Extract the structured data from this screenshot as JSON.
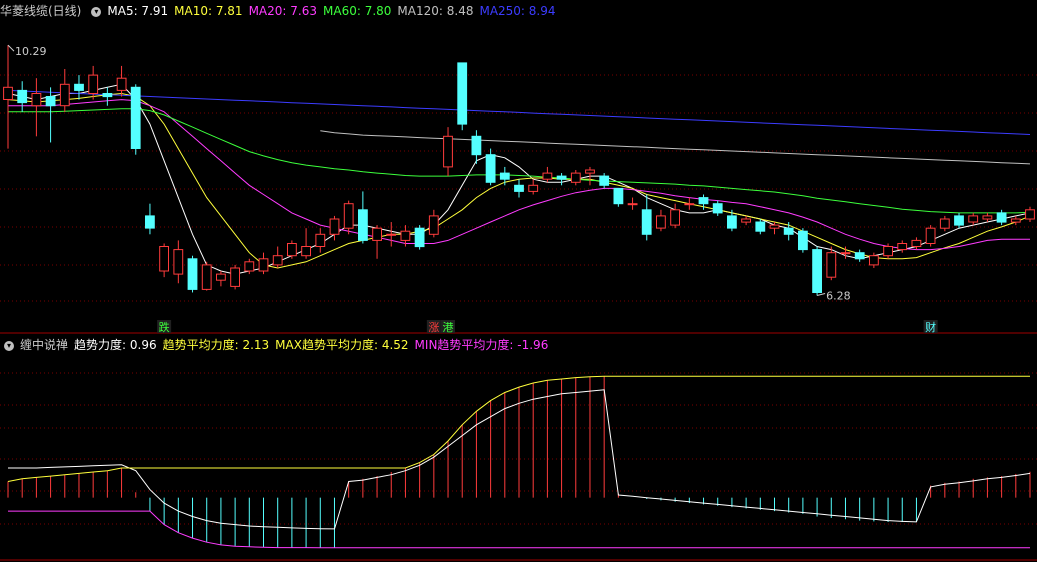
{
  "colors": {
    "bg": "#000000",
    "up": "#ff3c3c",
    "down": "#54ffff",
    "grid": "#7a0000",
    "ma5": "#ffffff",
    "ma10": "#ffff3c",
    "ma20": "#ff3cff",
    "ma60": "#3cff3c",
    "ma120": "#c0c0c0",
    "ma250": "#3c3cff",
    "axis": "#a00000"
  },
  "price_panel": {
    "title": "华菱线缆(日线)",
    "indicators": [
      {
        "label": "MA5: 7.91",
        "color": "#ffffff"
      },
      {
        "label": "MA10: 7.81",
        "color": "#ffff3c"
      },
      {
        "label": "MA20: 7.63",
        "color": "#ff3cff"
      },
      {
        "label": "MA60: 7.80",
        "color": "#3cff3c"
      },
      {
        "label": "MA120: 8.48",
        "color": "#c0c0c0"
      },
      {
        "label": "MA250: 8.94",
        "color": "#3c3cff"
      }
    ],
    "high_label": "10.29",
    "low_label": "6.28",
    "markers": [
      {
        "text": "跌",
        "index": 11,
        "color": "#3cff3c"
      },
      {
        "text": "涨",
        "index": 30,
        "color": "#ff3c3c"
      },
      {
        "text": "港",
        "index": 31,
        "color": "#3cff3c"
      },
      {
        "text": "财",
        "index": 65,
        "color": "#54ffff"
      }
    ]
  },
  "indicator_panel": {
    "title": "缠中说禅",
    "values": [
      {
        "label": "趋势力度: 0.96",
        "color": "#ffffff"
      },
      {
        "label": "趋势平均力度: 2.13",
        "color": "#ffff3c"
      },
      {
        "label": "MAX趋势平均力度: 4.52",
        "color": "#ffff3c"
      },
      {
        "label": "MIN趋势平均力度: -1.96",
        "color": "#ff3cff"
      }
    ]
  },
  "chart_data": [
    {
      "type": "candlestick",
      "title": "华菱线缆(日线)",
      "ylim": [
        5.8,
        10.7
      ],
      "candles": [
        [
          9.4,
          9.6,
          10.29,
          8.6
        ],
        [
          9.55,
          9.35,
          9.7,
          9.2
        ],
        [
          9.3,
          9.5,
          9.75,
          8.8
        ],
        [
          9.45,
          9.3,
          9.6,
          8.7
        ],
        [
          9.3,
          9.65,
          9.9,
          9.2
        ],
        [
          9.65,
          9.55,
          9.8,
          9.4
        ],
        [
          9.5,
          9.8,
          9.95,
          9.4
        ],
        [
          9.5,
          9.45,
          9.6,
          9.3
        ],
        [
          9.55,
          9.75,
          9.95,
          9.45
        ],
        [
          9.6,
          8.6,
          9.65,
          8.5
        ],
        [
          7.5,
          7.3,
          7.7,
          7.2
        ],
        [
          6.6,
          7.0,
          7.05,
          6.5
        ],
        [
          6.55,
          6.95,
          7.1,
          6.4
        ],
        [
          6.8,
          6.3,
          6.85,
          6.25
        ],
        [
          6.3,
          6.7,
          6.75,
          6.28
        ],
        [
          6.45,
          6.55,
          6.6,
          6.35
        ],
        [
          6.35,
          6.65,
          6.7,
          6.3
        ],
        [
          6.6,
          6.75,
          6.8,
          6.55
        ],
        [
          6.6,
          6.8,
          6.9,
          6.55
        ],
        [
          6.7,
          6.85,
          7.0,
          6.65
        ],
        [
          6.85,
          7.05,
          7.1,
          6.8
        ],
        [
          6.85,
          7.0,
          7.3,
          6.8
        ],
        [
          7.0,
          7.2,
          7.3,
          6.9
        ],
        [
          7.2,
          7.45,
          7.5,
          7.1
        ],
        [
          7.3,
          7.7,
          7.75,
          7.2
        ],
        [
          7.6,
          7.1,
          7.9,
          7.05
        ],
        [
          7.1,
          7.3,
          7.35,
          6.8
        ],
        [
          7.2,
          7.2,
          7.4,
          7.0
        ],
        [
          7.1,
          7.25,
          7.35,
          7.0
        ],
        [
          7.3,
          7.0,
          7.35,
          6.95
        ],
        [
          7.2,
          7.5,
          7.6,
          7.15
        ],
        [
          8.3,
          8.8,
          8.95,
          8.15
        ],
        [
          10.0,
          9.0,
          10.0,
          8.9
        ],
        [
          8.8,
          8.5,
          8.9,
          8.35
        ],
        [
          8.5,
          8.05,
          8.6,
          8.0
        ],
        [
          8.2,
          8.1,
          8.3,
          8.0
        ],
        [
          8.0,
          7.9,
          8.1,
          7.8
        ],
        [
          7.9,
          8.0,
          8.1,
          7.85
        ],
        [
          8.1,
          8.2,
          8.3,
          8.05
        ],
        [
          8.15,
          8.1,
          8.2,
          8.0
        ],
        [
          8.05,
          8.2,
          8.25,
          8.0
        ],
        [
          8.2,
          8.25,
          8.3,
          8.0
        ],
        [
          8.15,
          8.0,
          8.2,
          7.95
        ],
        [
          7.95,
          7.7,
          7.95,
          7.65
        ],
        [
          7.7,
          7.7,
          7.8,
          7.6
        ],
        [
          7.6,
          7.2,
          7.85,
          7.1
        ],
        [
          7.3,
          7.5,
          7.6,
          7.25
        ],
        [
          7.35,
          7.6,
          7.7,
          7.3
        ],
        [
          7.7,
          7.7,
          7.8,
          7.6
        ],
        [
          7.8,
          7.7,
          7.85,
          7.6
        ],
        [
          7.7,
          7.55,
          7.75,
          7.5
        ],
        [
          7.5,
          7.3,
          7.6,
          7.25
        ],
        [
          7.4,
          7.45,
          7.5,
          7.35
        ],
        [
          7.4,
          7.25,
          7.45,
          7.2
        ],
        [
          7.3,
          7.35,
          7.4,
          7.2
        ],
        [
          7.3,
          7.2,
          7.4,
          7.1
        ],
        [
          7.25,
          6.95,
          7.3,
          6.9
        ],
        [
          6.95,
          6.25,
          7.0,
          6.2
        ],
        [
          6.5,
          6.9,
          7.0,
          6.45
        ],
        [
          6.9,
          6.9,
          7.0,
          6.8
        ],
        [
          6.9,
          6.8,
          6.95,
          6.75
        ],
        [
          6.7,
          6.85,
          6.9,
          6.65
        ],
        [
          6.85,
          7.0,
          7.05,
          6.8
        ],
        [
          6.95,
          7.05,
          7.1,
          6.9
        ],
        [
          7.0,
          7.1,
          7.15,
          6.95
        ],
        [
          7.05,
          7.3,
          7.35,
          7.0
        ],
        [
          7.3,
          7.45,
          7.5,
          7.25
        ],
        [
          7.5,
          7.35,
          7.55,
          7.3
        ],
        [
          7.4,
          7.5,
          7.55,
          7.35
        ],
        [
          7.45,
          7.5,
          7.55,
          7.4
        ],
        [
          7.55,
          7.4,
          7.6,
          7.35
        ],
        [
          7.4,
          7.45,
          7.5,
          7.35
        ],
        [
          7.45,
          7.6,
          7.65,
          7.4
        ]
      ],
      "ma": {
        "MA5": [
          9.5,
          9.45,
          9.4,
          9.45,
          9.5,
          9.5,
          9.55,
          9.6,
          9.65,
          9.4,
          9.0,
          8.4,
          7.8,
          7.2,
          6.7,
          6.6,
          6.55,
          6.6,
          6.65,
          6.75,
          6.85,
          6.95,
          7.05,
          7.2,
          7.35,
          7.35,
          7.3,
          7.25,
          7.2,
          7.2,
          7.35,
          7.6,
          8.0,
          8.4,
          8.5,
          8.45,
          8.3,
          8.1,
          8.05,
          8.05,
          8.1,
          8.15,
          8.15,
          8.05,
          7.95,
          7.8,
          7.7,
          7.6,
          7.55,
          7.55,
          7.6,
          7.55,
          7.5,
          7.45,
          7.35,
          7.3,
          7.15,
          7.0,
          6.95,
          6.85,
          6.8,
          6.85,
          6.9,
          6.95,
          7.0,
          7.1,
          7.2,
          7.3,
          7.35,
          7.4,
          7.45,
          7.5,
          7.55
        ],
        "MA10": [
          9.4,
          9.38,
          9.36,
          9.38,
          9.4,
          9.42,
          9.45,
          9.48,
          9.5,
          9.45,
          9.3,
          9.0,
          8.6,
          8.2,
          7.8,
          7.5,
          7.2,
          6.9,
          6.7,
          6.65,
          6.7,
          6.75,
          6.85,
          6.95,
          7.05,
          7.1,
          7.15,
          7.2,
          7.2,
          7.25,
          7.3,
          7.45,
          7.6,
          7.8,
          7.95,
          8.05,
          8.1,
          8.12,
          8.12,
          8.1,
          8.1,
          8.1,
          8.05,
          8.0,
          7.95,
          7.85,
          7.8,
          7.75,
          7.7,
          7.65,
          7.6,
          7.55,
          7.5,
          7.45,
          7.4,
          7.35,
          7.25,
          7.15,
          7.05,
          6.95,
          6.88,
          6.82,
          6.8,
          6.8,
          6.82,
          6.9,
          6.98,
          7.05,
          7.15,
          7.25,
          7.32,
          7.4,
          7.5
        ],
        "MA20": [
          9.3,
          9.3,
          9.3,
          9.3,
          9.32,
          9.34,
          9.36,
          9.38,
          9.4,
          9.38,
          9.3,
          9.2,
          9.0,
          8.8,
          8.6,
          8.4,
          8.2,
          8.0,
          7.85,
          7.7,
          7.55,
          7.45,
          7.35,
          7.3,
          7.25,
          7.2,
          7.15,
          7.1,
          7.05,
          7.05,
          7.05,
          7.1,
          7.2,
          7.3,
          7.4,
          7.5,
          7.6,
          7.68,
          7.75,
          7.82,
          7.88,
          7.92,
          7.95,
          7.95,
          7.93,
          7.9,
          7.87,
          7.83,
          7.8,
          7.77,
          7.75,
          7.72,
          7.7,
          7.65,
          7.6,
          7.55,
          7.48,
          7.4,
          7.3,
          7.2,
          7.12,
          7.05,
          7.0,
          6.97,
          6.95,
          6.95,
          6.97,
          7.0,
          7.05,
          7.1,
          7.12,
          7.12,
          7.12
        ],
        "MA60": [
          9.2,
          9.2,
          9.2,
          9.2,
          9.21,
          9.22,
          9.23,
          9.24,
          9.25,
          9.25,
          9.22,
          9.15,
          9.05,
          8.95,
          8.85,
          8.75,
          8.65,
          8.55,
          8.48,
          8.42,
          8.37,
          8.33,
          8.3,
          8.27,
          8.25,
          8.22,
          8.2,
          8.18,
          8.16,
          8.15,
          8.15,
          8.15,
          8.16,
          8.17,
          8.17,
          8.17,
          8.16,
          8.15,
          8.13,
          8.12,
          8.1,
          8.08,
          8.07,
          8.06,
          8.05,
          8.04,
          8.03,
          8.02,
          8.0,
          7.99,
          7.97,
          7.95,
          7.93,
          7.91,
          7.89,
          7.86,
          7.83,
          7.79,
          7.76,
          7.73,
          7.7,
          7.67,
          7.64,
          7.61,
          7.59,
          7.57,
          7.56,
          7.55,
          7.55,
          7.55,
          7.55,
          7.55,
          7.56
        ],
        "MA120": [
          null,
          null,
          null,
          null,
          null,
          null,
          null,
          null,
          null,
          null,
          null,
          null,
          null,
          null,
          null,
          null,
          null,
          null,
          null,
          null,
          null,
          null,
          8.89,
          8.86,
          8.84,
          8.82,
          8.81,
          8.8,
          8.79,
          8.78,
          8.77,
          8.76,
          8.75,
          8.74,
          8.73,
          8.72,
          8.71,
          8.7,
          8.69,
          8.68,
          8.67,
          8.66,
          8.65,
          8.64,
          8.63,
          8.62,
          8.61,
          8.6,
          8.59,
          8.58,
          8.57,
          8.56,
          8.55,
          8.54,
          8.53,
          8.52,
          8.51,
          8.5,
          8.49,
          8.48,
          8.47,
          8.46,
          8.45,
          8.44,
          8.43,
          8.42,
          8.41,
          8.4,
          8.39,
          8.38,
          8.37,
          8.36,
          8.35
        ],
        "MA250": [
          9.55,
          9.54,
          9.53,
          9.52,
          9.51,
          9.5,
          9.49,
          9.48,
          9.47,
          9.46,
          9.45,
          9.44,
          9.43,
          9.42,
          9.41,
          9.4,
          9.39,
          9.38,
          9.37,
          9.36,
          9.35,
          9.34,
          9.33,
          9.32,
          9.31,
          9.3,
          9.29,
          9.28,
          9.27,
          9.26,
          9.25,
          9.24,
          9.23,
          9.22,
          9.21,
          9.2,
          9.19,
          9.18,
          9.17,
          9.16,
          9.15,
          9.14,
          9.13,
          9.12,
          9.11,
          9.1,
          9.09,
          9.08,
          9.07,
          9.06,
          9.05,
          9.04,
          9.03,
          9.02,
          9.01,
          9.0,
          8.99,
          8.98,
          8.97,
          8.96,
          8.95,
          8.94,
          8.93,
          8.92,
          8.91,
          8.9,
          8.89,
          8.88,
          8.87,
          8.86,
          8.85,
          8.84,
          8.83
        ]
      }
    },
    {
      "type": "bar",
      "title": "缠中说禅",
      "ylim": [
        -2.2,
        5.4
      ],
      "zero": 0,
      "trend": [
        0.6,
        0.7,
        0.75,
        0.8,
        0.85,
        0.9,
        0.95,
        1.0,
        1.1,
        0.2,
        -0.5,
        -1.0,
        -1.3,
        -1.5,
        -1.65,
        -1.75,
        -1.8,
        -1.82,
        -1.84,
        -1.85,
        -1.85,
        -1.85,
        -1.86,
        -1.86,
        0.6,
        0.7,
        0.8,
        0.95,
        1.1,
        1.3,
        1.6,
        2.1,
        2.7,
        3.2,
        3.6,
        3.9,
        4.1,
        4.25,
        4.35,
        4.4,
        4.45,
        4.48,
        4.5,
        0.15,
        0.0,
        -0.05,
        -0.1,
        -0.15,
        -0.2,
        -0.25,
        -0.3,
        -0.35,
        -0.4,
        -0.45,
        -0.5,
        -0.55,
        -0.6,
        -0.7,
        -0.75,
        -0.8,
        -0.85,
        -0.88,
        -0.9,
        -0.9,
        -0.9,
        0.45,
        0.55,
        0.6,
        0.7,
        0.75,
        0.8,
        0.88,
        0.96
      ],
      "avg": [
        1.1,
        1.1,
        1.1,
        1.12,
        1.14,
        1.16,
        1.18,
        1.2,
        1.22,
        1.0,
        0.3,
        -0.2,
        -0.5,
        -0.7,
        -0.85,
        -0.95,
        -1.0,
        -1.05,
        -1.08,
        -1.1,
        -1.12,
        -1.14,
        -1.15,
        -1.16,
        0.6,
        0.65,
        0.75,
        0.85,
        1.0,
        1.2,
        1.5,
        1.9,
        2.3,
        2.7,
        3.0,
        3.3,
        3.5,
        3.65,
        3.75,
        3.85,
        3.9,
        3.95,
        4.0,
        0.1,
        0.05,
        0.0,
        -0.05,
        -0.1,
        -0.15,
        -0.2,
        -0.25,
        -0.3,
        -0.35,
        -0.4,
        -0.45,
        -0.5,
        -0.55,
        -0.6,
        -0.65,
        -0.7,
        -0.75,
        -0.8,
        -0.85,
        -0.88,
        -0.9,
        0.4,
        0.5,
        0.55,
        0.62,
        0.7,
        0.75,
        0.82,
        0.9
      ],
      "max": 4.52,
      "min": -1.96
    }
  ]
}
